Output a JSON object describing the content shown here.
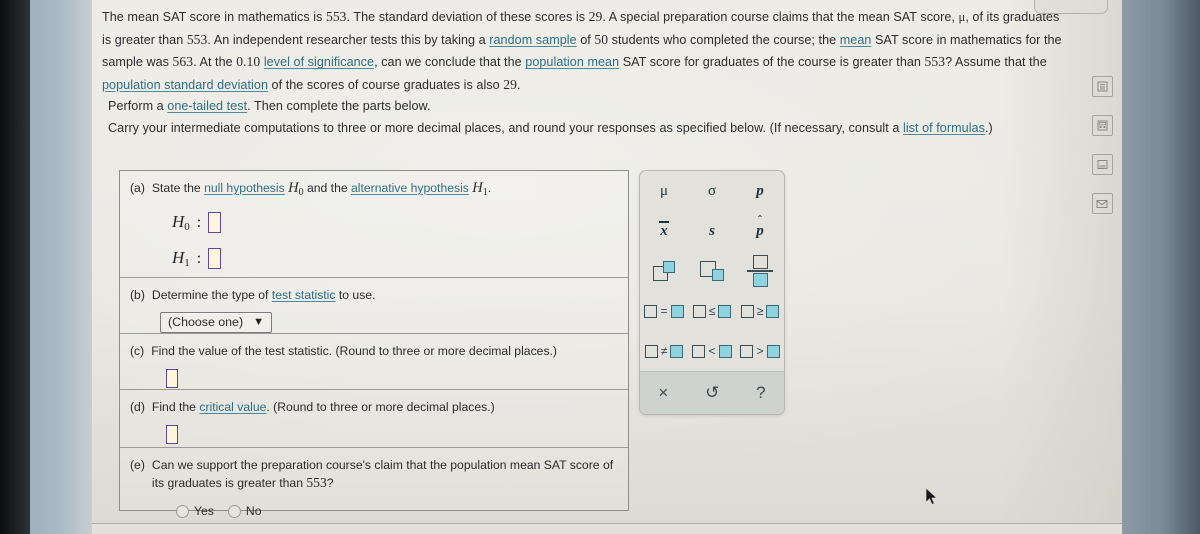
{
  "problem": {
    "paragraph_parts": [
      {
        "t": "The mean SAT score in mathematics is ",
        "k": "plain"
      },
      {
        "t": "553",
        "k": "num"
      },
      {
        "t": ". The standard deviation of these scores is ",
        "k": "plain"
      },
      {
        "t": "29",
        "k": "num"
      },
      {
        "t": ". A special preparation course claims that the mean SAT score, ",
        "k": "plain"
      },
      {
        "t": "μ",
        "k": "sym"
      },
      {
        "t": ", of its graduates is greater than ",
        "k": "plain"
      },
      {
        "t": "553",
        "k": "num"
      },
      {
        "t": ". An independent researcher tests this by taking a ",
        "k": "plain"
      },
      {
        "t": "random sample",
        "k": "link"
      },
      {
        "t": " of ",
        "k": "plain"
      },
      {
        "t": "50",
        "k": "num"
      },
      {
        "t": " students who completed the course; the ",
        "k": "plain"
      },
      {
        "t": "mean",
        "k": "link"
      },
      {
        "t": " SAT score in mathematics for the sample was ",
        "k": "plain"
      },
      {
        "t": "563",
        "k": "num"
      },
      {
        "t": ". At the ",
        "k": "plain"
      },
      {
        "t": "0.10",
        "k": "num"
      },
      {
        "t": " ",
        "k": "plain"
      },
      {
        "t": "level of significance",
        "k": "link"
      },
      {
        "t": ", can we conclude that the ",
        "k": "plain"
      },
      {
        "t": "population mean",
        "k": "link"
      },
      {
        "t": " SAT score for graduates of the course is greater than ",
        "k": "plain"
      },
      {
        "t": "553",
        "k": "num"
      },
      {
        "t": "? Assume that the ",
        "k": "plain"
      },
      {
        "t": "population standard deviation",
        "k": "link"
      },
      {
        "t": " of the scores of course graduates is also ",
        "k": "plain"
      },
      {
        "t": "29",
        "k": "num"
      },
      {
        "t": ".",
        "k": "plain"
      }
    ],
    "perform_parts": [
      {
        "t": "Perform a ",
        "k": "plain"
      },
      {
        "t": "one-tailed test",
        "k": "link"
      },
      {
        "t": ". Then complete the parts below.",
        "k": "plain"
      }
    ],
    "carry_parts": [
      {
        "t": "Carry your intermediate computations to three or more decimal places, and round your responses as specified below. (If necessary, consult a ",
        "k": "plain"
      },
      {
        "t": "list of formulas",
        "k": "link"
      },
      {
        "t": ".)",
        "k": "plain"
      }
    ]
  },
  "parts": {
    "a": {
      "tag": "(a)",
      "prompt_parts": [
        {
          "t": "State the ",
          "k": "plain"
        },
        {
          "t": "null hypothesis",
          "k": "link"
        },
        {
          "t": " H₀",
          "k": "mathH0"
        },
        {
          "t": " and the ",
          "k": "plain"
        },
        {
          "t": "alternative hypothesis",
          "k": "link"
        },
        {
          "t": " H₁",
          "k": "mathH1"
        },
        {
          "t": ".",
          "k": "plain"
        }
      ],
      "h0_label": "H",
      "h0_sub": "0",
      "h1_label": "H",
      "h1_sub": "1",
      "colon": ":",
      "h0_value": "",
      "h1_value": ""
    },
    "b": {
      "tag": "(b)",
      "prompt_parts": [
        {
          "t": "Determine the type of ",
          "k": "plain"
        },
        {
          "t": "test statistic",
          "k": "link"
        },
        {
          "t": " to use.",
          "k": "plain"
        }
      ],
      "select_value": "(Choose one)",
      "select_caret": "▼"
    },
    "c": {
      "tag": "(c)",
      "prompt_parts": [
        {
          "t": "Find the value of the test statistic. (Round to three or more decimal places.)",
          "k": "plain"
        }
      ],
      "value": ""
    },
    "d": {
      "tag": "(d)",
      "prompt_parts": [
        {
          "t": "Find the ",
          "k": "plain"
        },
        {
          "t": "critical value",
          "k": "link"
        },
        {
          "t": ". (Round to three or more decimal places.)",
          "k": "plain"
        }
      ],
      "value": ""
    },
    "e": {
      "tag": "(e)",
      "prompt_parts": [
        {
          "t": "Can we support the preparation course's claim that the population mean SAT score of its graduates is greater than ",
          "k": "plain"
        },
        {
          "t": "553",
          "k": "num"
        },
        {
          "t": "?",
          "k": "plain"
        }
      ],
      "options": [
        "Yes",
        "No"
      ],
      "selected": ""
    }
  },
  "palette": {
    "rows": [
      [
        {
          "name": "mu-symbol",
          "glyph": "μ",
          "kind": "text"
        },
        {
          "name": "sigma-symbol",
          "glyph": "σ",
          "kind": "text"
        },
        {
          "name": "p-symbol",
          "glyph": "p",
          "kind": "italic"
        }
      ],
      [
        {
          "name": "x-bar-symbol",
          "glyph": "x",
          "kind": "overbar"
        },
        {
          "name": "s-symbol",
          "glyph": "s",
          "kind": "italic"
        },
        {
          "name": "p-hat-symbol",
          "glyph": "p",
          "kind": "hat"
        }
      ],
      [
        {
          "name": "superscript-box",
          "glyph": "□□",
          "kind": "superscript"
        },
        {
          "name": "subscript-box",
          "glyph": "□□",
          "kind": "subscript"
        },
        {
          "name": "fraction-box",
          "glyph": "□/□",
          "kind": "fraction"
        }
      ],
      [
        {
          "name": "equals-relation",
          "glyph": "=",
          "kind": "relation"
        },
        {
          "name": "less-equal-relation",
          "glyph": "≤",
          "kind": "relation"
        },
        {
          "name": "greater-equal-relation",
          "glyph": "≥",
          "kind": "relation"
        }
      ],
      [
        {
          "name": "not-equal-relation",
          "glyph": "≠",
          "kind": "relation"
        },
        {
          "name": "less-than-relation",
          "glyph": "<",
          "kind": "relation"
        },
        {
          "name": "greater-than-relation",
          "glyph": ">",
          "kind": "relation"
        }
      ]
    ],
    "footer": [
      {
        "name": "clear-button",
        "glyph": "×"
      },
      {
        "name": "undo-button",
        "glyph": "↺"
      },
      {
        "name": "help-button",
        "glyph": "?"
      }
    ]
  },
  "rail": {
    "icons": [
      {
        "name": "calculator-icon"
      },
      {
        "name": "keypad-icon"
      },
      {
        "name": "notes-icon"
      },
      {
        "name": "message-icon"
      }
    ]
  },
  "colors": {
    "link": "#2f6f82",
    "input_border": "#5b4b9a",
    "input_fill": "#fdf6dd",
    "palette_fill": "#8fd2e0",
    "page_bg": "#ecebe6"
  }
}
